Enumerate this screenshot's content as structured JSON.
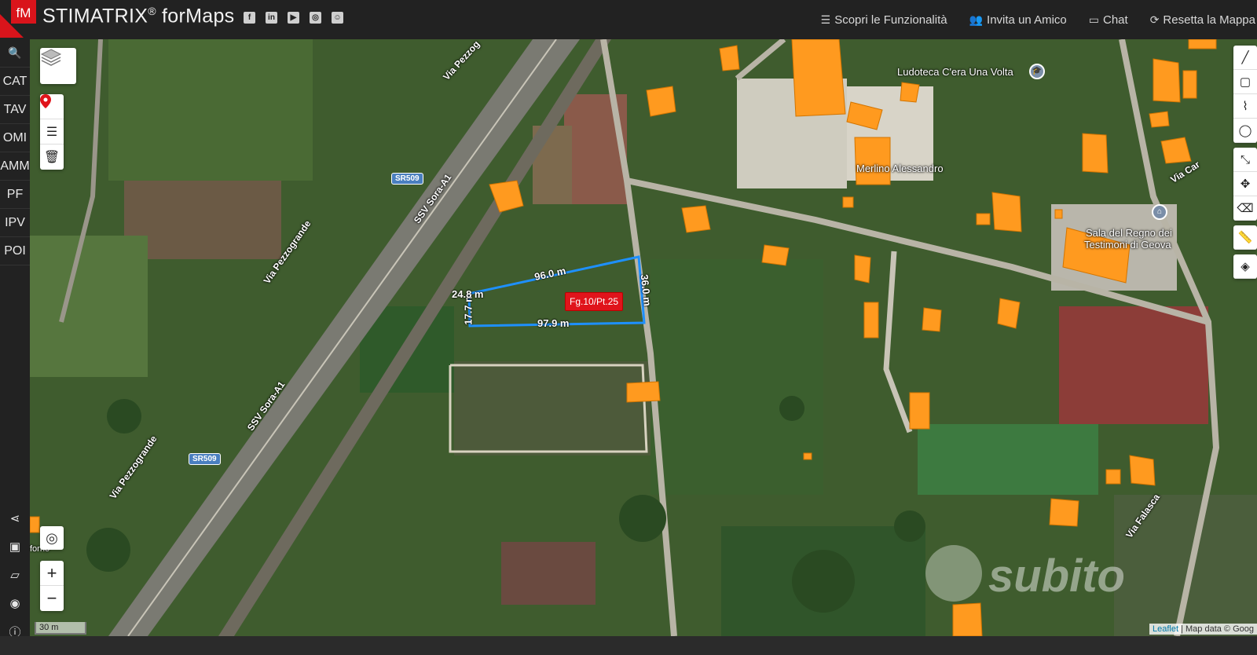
{
  "brand": {
    "logo_text": "fM",
    "name": "STIMATRIX",
    "reg": "®",
    "suffix": " forMaps"
  },
  "social": [
    {
      "icon": "facebook-icon",
      "glyph": "f"
    },
    {
      "icon": "linkedin-icon",
      "glyph": "in"
    },
    {
      "icon": "youtube-icon",
      "glyph": "▶"
    },
    {
      "icon": "instagram-icon",
      "glyph": "◎"
    },
    {
      "icon": "settings-icon",
      "glyph": "☺"
    }
  ],
  "topnav": [
    {
      "icon": "list-icon",
      "glyph": "☰",
      "label": "Scopri le Funzionalità"
    },
    {
      "icon": "users-icon",
      "glyph": "👥",
      "label": "Invita un Amico"
    },
    {
      "icon": "chat-icon",
      "glyph": "▭",
      "label": "Chat"
    },
    {
      "icon": "refresh-icon",
      "glyph": "⟳",
      "label": "Resetta la Mappa"
    }
  ],
  "sidebar": {
    "search_glyph": "🔍",
    "items": [
      "CAT",
      "TAV",
      "OMI",
      "AMM",
      "PF",
      "IPV",
      "POI"
    ],
    "bottom": [
      {
        "icon": "share-icon",
        "glyph": "⋖"
      },
      {
        "icon": "save-icon",
        "glyph": "▣"
      },
      {
        "icon": "folder-icon",
        "glyph": "▱"
      },
      {
        "icon": "eye-icon",
        "glyph": "◉"
      },
      {
        "icon": "info-icon",
        "glyph": "ⓘ"
      }
    ]
  },
  "map": {
    "parcel_label": "Fg.10/Pt.25",
    "dimensions": {
      "top": "96.0 m",
      "right": "36.0 m",
      "bottom": "97.9 m",
      "left": "17.7 m",
      "short": "24.8 m"
    },
    "places": {
      "ludoteca": "Ludoteca C'era Una Volta",
      "merlino": "Merlino Alessandro",
      "regno_1": "Sala del Regno dei",
      "regno_2": "Testimoni di Geova"
    },
    "roads": {
      "pezzo_top": "Via Pezzog",
      "pezzogrande_1": "Via Pezzogrande",
      "pezzogrande_2": "Via Pezzogrande",
      "ssv_1": "SSV Sora-A1",
      "ssv_2": "SSV Sora-A1",
      "falasca": "Via Falasca",
      "car": "Via Car",
      "sr509_1": "SR509",
      "sr509_2": "SR509",
      "forno": "forno"
    },
    "scale": "30 m",
    "attribution": {
      "leaflet": "Leaflet",
      "rest": " | Map data © Goog"
    },
    "watermark": "subito",
    "zoom_in": "+",
    "zoom_out": "−"
  },
  "colors": {
    "parcel_outline": "#1e90ff",
    "building": "#ff9a1f",
    "tag": "#e0141b",
    "brand_red": "#d9141b"
  }
}
